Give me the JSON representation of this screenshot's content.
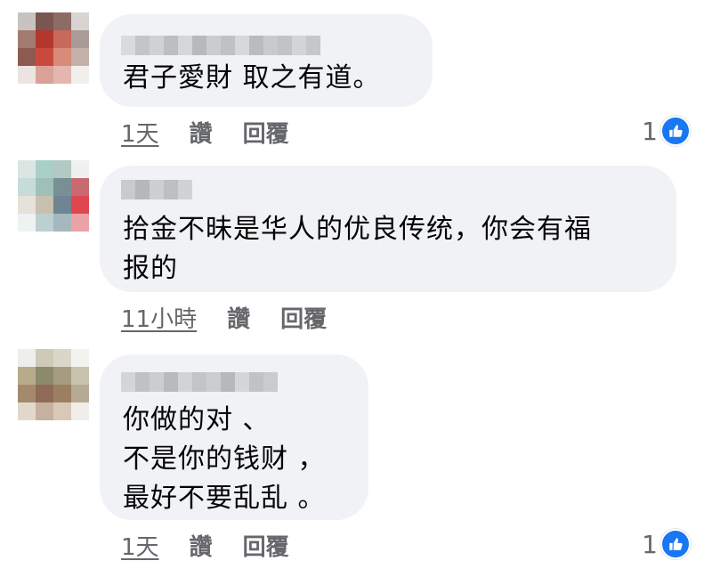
{
  "colors": {
    "bubble_bg": "#f0f2f5",
    "meta_text": "#65676b",
    "like_blue": "#1877f2"
  },
  "comments": [
    {
      "author_redacted": true,
      "text": "君子愛財 取之有道。",
      "time": "1天",
      "like_label": "讚",
      "reply_label": "回覆",
      "reaction_count": "1",
      "reaction_icon": "thumbs-up-icon"
    },
    {
      "author_redacted": true,
      "text": "拾金不昧是华人的优良传统，你会有福\n报的",
      "time": "11小時",
      "like_label": "讚",
      "reply_label": "回覆"
    },
    {
      "author_redacted": true,
      "text": "你做的对 、\n不是你的钱财 ，\n最好不要乱乱 。",
      "time": "1天",
      "like_label": "讚",
      "reply_label": "回覆",
      "reaction_count": "1",
      "reaction_icon": "thumbs-up-icon"
    }
  ]
}
